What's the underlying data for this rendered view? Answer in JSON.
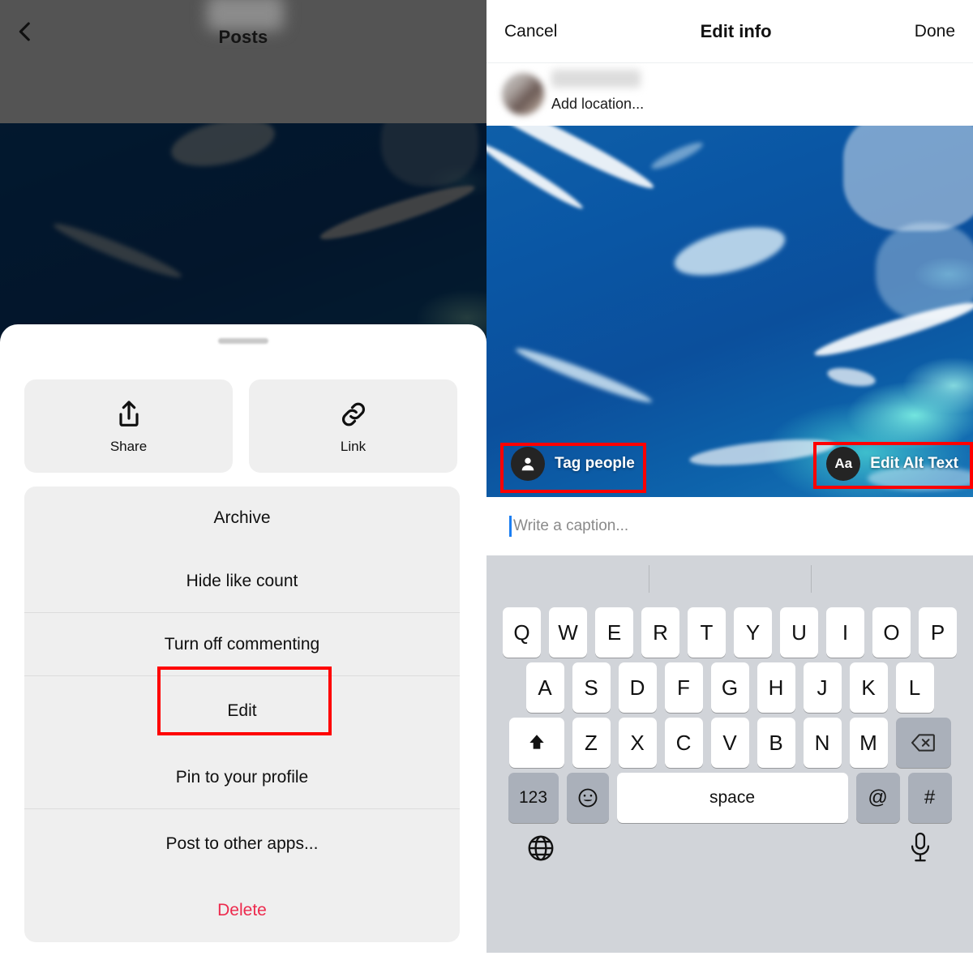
{
  "left_panel": {
    "header": {
      "back_icon": "chevron-left-icon",
      "title": "Posts",
      "more_icon": "more-options-icon"
    },
    "post": {
      "username_redacted": "",
      "avatar": "user-avatar"
    },
    "action_sheet": {
      "tiles": [
        {
          "label": "Share",
          "icon": "share-icon"
        },
        {
          "label": "Link",
          "icon": "link-icon"
        }
      ],
      "items": [
        {
          "label": "Archive",
          "style": "default",
          "separator": false
        },
        {
          "label": "Hide like count",
          "style": "default",
          "separator": false
        },
        {
          "label": "Turn off commenting",
          "style": "default",
          "separator": true
        },
        {
          "label": "Edit",
          "style": "default",
          "separator": true,
          "highlighted": true
        },
        {
          "label": "Pin to your profile",
          "style": "default",
          "separator": false
        },
        {
          "label": "Post to other apps...",
          "style": "default",
          "separator": true
        },
        {
          "label": "Delete",
          "style": "danger",
          "separator": false
        }
      ]
    }
  },
  "right_panel": {
    "header": {
      "cancel_label": "Cancel",
      "title": "Edit info",
      "done_label": "Done"
    },
    "meta": {
      "username_redacted": "",
      "location_label": "Add location...",
      "avatar": "user-avatar"
    },
    "photo_overlay": {
      "tag_people": {
        "label": "Tag people",
        "icon": "person-icon",
        "highlighted": true
      },
      "edit_alt_text": {
        "label": "Edit Alt Text",
        "icon": "alt-text-icon",
        "badge": "Aa",
        "highlighted": true
      }
    },
    "caption": {
      "placeholder": "Write a caption...",
      "value": ""
    },
    "keyboard": {
      "row1": [
        "Q",
        "W",
        "E",
        "R",
        "T",
        "Y",
        "U",
        "I",
        "O",
        "P"
      ],
      "row2": [
        "A",
        "S",
        "D",
        "F",
        "G",
        "H",
        "J",
        "K",
        "L"
      ],
      "row3": [
        "Z",
        "X",
        "C",
        "V",
        "B",
        "N",
        "M"
      ],
      "shift_icon": "shift-icon",
      "backspace_icon": "backspace-icon",
      "numbers_label": "123",
      "emoji_icon": "emoji-icon",
      "space_label": "space",
      "at_label": "@",
      "hash_label": "#",
      "globe_icon": "globe-icon",
      "mic_icon": "microphone-icon"
    }
  },
  "annotations": {
    "highlight_color": "#ff0000",
    "boxes": [
      "edit-menu-item",
      "tag-people-button",
      "edit-alt-text-button"
    ]
  }
}
